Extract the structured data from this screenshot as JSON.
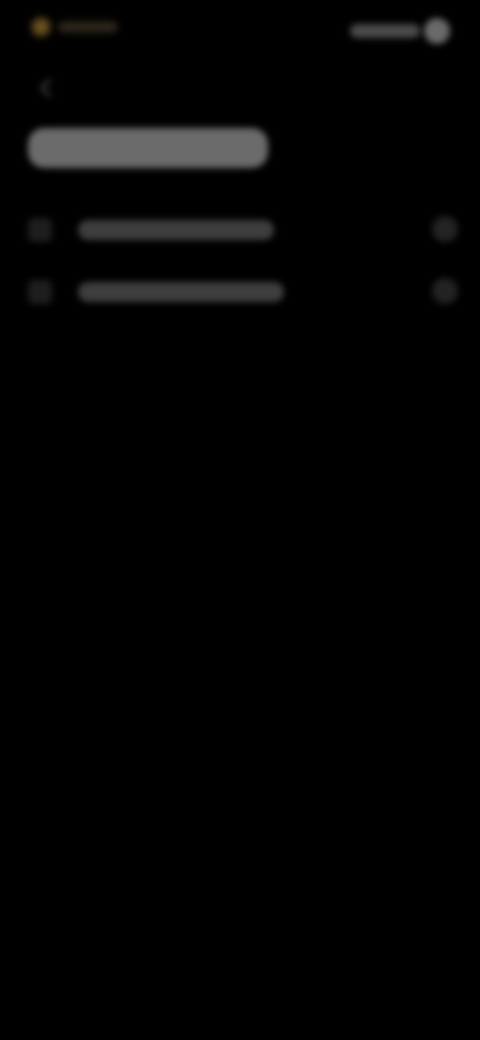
{
  "status_bar": {
    "left_icon": "status-indicator-icon",
    "right_icon": "battery-icon"
  },
  "header": {
    "back_icon": "back-arrow-icon"
  },
  "settings": {
    "rows": [
      {
        "icon": "settings-row-icon",
        "trailing_icon": "toggle-icon"
      },
      {
        "icon": "settings-row-icon",
        "trailing_icon": "toggle-icon"
      }
    ]
  },
  "colors": {
    "background": "#000000",
    "title_blur": "#6b6b6b",
    "row_blur": "#3e3e3e",
    "accent_dim": "#8a6a2a"
  }
}
